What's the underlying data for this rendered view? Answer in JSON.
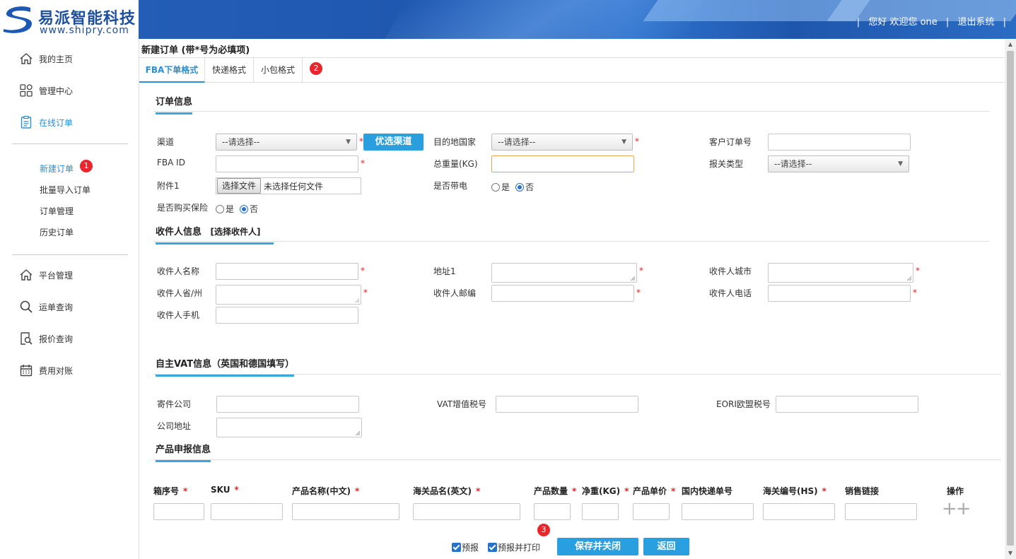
{
  "brand": {
    "name_cn": "易派智能科技",
    "url": "www.shipry.com"
  },
  "header": {
    "sep": "|",
    "greeting": "您好 欢迎您 one",
    "logout": "退出系统"
  },
  "sidebar": {
    "items": [
      {
        "label": "我的主页",
        "icon": "home-icon"
      },
      {
        "label": "管理中心",
        "icon": "grid-icon"
      },
      {
        "label": "在线订单",
        "icon": "clipboard-icon"
      }
    ],
    "sub_items": [
      {
        "label": "新建订单",
        "badge": "1"
      },
      {
        "label": "批量导入订单"
      },
      {
        "label": "订单管理"
      },
      {
        "label": "历史订单"
      }
    ],
    "items2": [
      {
        "label": "平台管理",
        "icon": "home-icon"
      },
      {
        "label": "运单查询",
        "icon": "search-icon"
      },
      {
        "label": "报价查询",
        "icon": "quote-search-icon"
      },
      {
        "label": "费用对账",
        "icon": "calendar-icon"
      }
    ]
  },
  "page": {
    "title": "新建订单 (带*号为必填项)",
    "tabs": [
      "FBA下单格式",
      "快递格式",
      "小包格式"
    ],
    "tab_badge": "2"
  },
  "order_info": {
    "title": "订单信息",
    "channel_label": "渠道",
    "channel_value": "--请选择--",
    "preferred_channel_button": "优选渠道",
    "dest_country_label": "目的地国家",
    "dest_country_value": "--请选择--",
    "customer_order_label": "客户订单号",
    "fba_id_label": "FBA ID",
    "total_weight_label": "总重量(KG)",
    "customs_type_label": "报关类型",
    "customs_type_value": "--请选择--",
    "attachment_label": "附件1",
    "file_button": "选择文件",
    "file_status": "未选择任何文件",
    "battery_label": "是否带电",
    "insurance_label": "是否购买保险",
    "yes": "是",
    "no": "否",
    "required_mark": "*"
  },
  "recipient": {
    "title": "收件人信息",
    "select_link": "[选择收件人]",
    "name_label": "收件人名称",
    "address_label": "地址1",
    "city_label": "收件人城市",
    "province_label": "收件人省/州",
    "postcode_label": "收件人邮编",
    "phone_label": "收件人电话",
    "mobile_label": "收件人手机"
  },
  "vat": {
    "title": "自主VAT信息（英国和德国填写）",
    "sender_company_label": "寄件公司",
    "vat_label": "VAT增值税号",
    "eori_label": "EORI欧盟税号",
    "company_address_label": "公司地址"
  },
  "product": {
    "title": "产品申报信息",
    "columns": [
      {
        "label": "箱序号",
        "required": true
      },
      {
        "label": "SKU",
        "required": true
      },
      {
        "label": "产品名称(中文)",
        "required": true
      },
      {
        "label": "海关品名(英文)",
        "required": true
      },
      {
        "label": "产品数量",
        "required": true
      },
      {
        "label": "净重(KG)",
        "required": true
      },
      {
        "label": "产品单价",
        "required": true
      },
      {
        "label": "国内快递单号",
        "required": false
      },
      {
        "label": "海关编号(HS)",
        "required": true
      },
      {
        "label": "销售链接",
        "required": false
      },
      {
        "label": "操作",
        "required": false
      }
    ],
    "add_symbol": "++"
  },
  "footer": {
    "badge": "3",
    "declare_label": "预报",
    "declare_print_label": "预报并打印",
    "save_close_button": "保存并关闭",
    "back_button": "返回"
  },
  "colors": {
    "accent": "#2a9fe0",
    "header_blue": "#2560b8",
    "required": "#dd2222",
    "badge": "#e8262b"
  }
}
